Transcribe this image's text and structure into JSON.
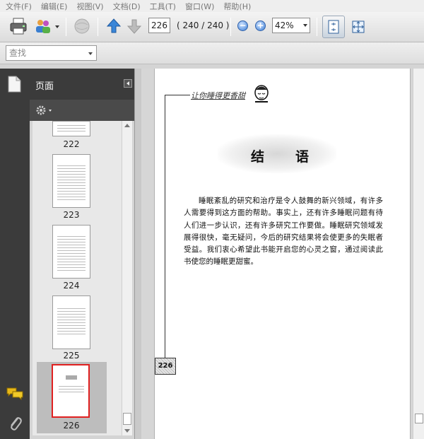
{
  "menu": [
    "文件(F)",
    "编辑(E)",
    "视图(V)",
    "文档(D)",
    "工具(T)",
    "窗口(W)",
    "帮助(H)"
  ],
  "toolbar": {
    "current_page": "226",
    "page_count": "( 240 / 240 )",
    "zoom": "42%"
  },
  "find": {
    "placeholder": "查找"
  },
  "panel": {
    "title": "页面",
    "thumbnails": [
      {
        "label": "222"
      },
      {
        "label": "223"
      },
      {
        "label": "224"
      },
      {
        "label": "225"
      },
      {
        "label": "226",
        "selected": true
      }
    ]
  },
  "document": {
    "header": "让你睡得更香甜",
    "title": "结语",
    "body": "睡眠紊乱的研究和治疗是令人鼓舞的新兴领域，有许多人需要得到这方面的帮助。事实上，还有许多睡眠问题有待人们进一步认识，还有许多研究工作要做。睡眠研究领域发展得很快，毫无疑问，今后的研究结果将会使更多的失眠者受益。我们衷心希望此书能开启您的心灵之窗，通过阅读此书使您的睡眠更甜蜜。",
    "page_number": "226"
  },
  "colors": {
    "selected_border": "#e02020",
    "panel_dark": "#3b3b3b",
    "accent_blue": "#3d7fd6"
  }
}
